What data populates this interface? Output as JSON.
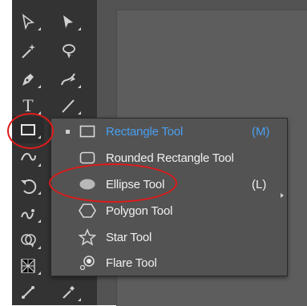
{
  "toolbar": {
    "type_tool_glyph": "T"
  },
  "flyout": {
    "items": [
      {
        "label": "Rectangle Tool",
        "shortcut": "(M)",
        "icon": "rectangle-icon",
        "selected": true
      },
      {
        "label": "Rounded Rectangle Tool",
        "shortcut": "",
        "icon": "rounded-rectangle-icon",
        "selected": false
      },
      {
        "label": "Ellipse Tool",
        "shortcut": "(L)",
        "icon": "ellipse-icon",
        "selected": false
      },
      {
        "label": "Polygon Tool",
        "shortcut": "",
        "icon": "polygon-icon",
        "selected": false
      },
      {
        "label": "Star Tool",
        "shortcut": "",
        "icon": "star-icon",
        "selected": false
      },
      {
        "label": "Flare Tool",
        "shortcut": "",
        "icon": "flare-icon",
        "selected": false
      }
    ]
  },
  "colors": {
    "toolbar_bg": "#333333",
    "flyout_bg": "#535353",
    "selected_text": "#4a9ff0",
    "annotation": "#e01a1a"
  }
}
